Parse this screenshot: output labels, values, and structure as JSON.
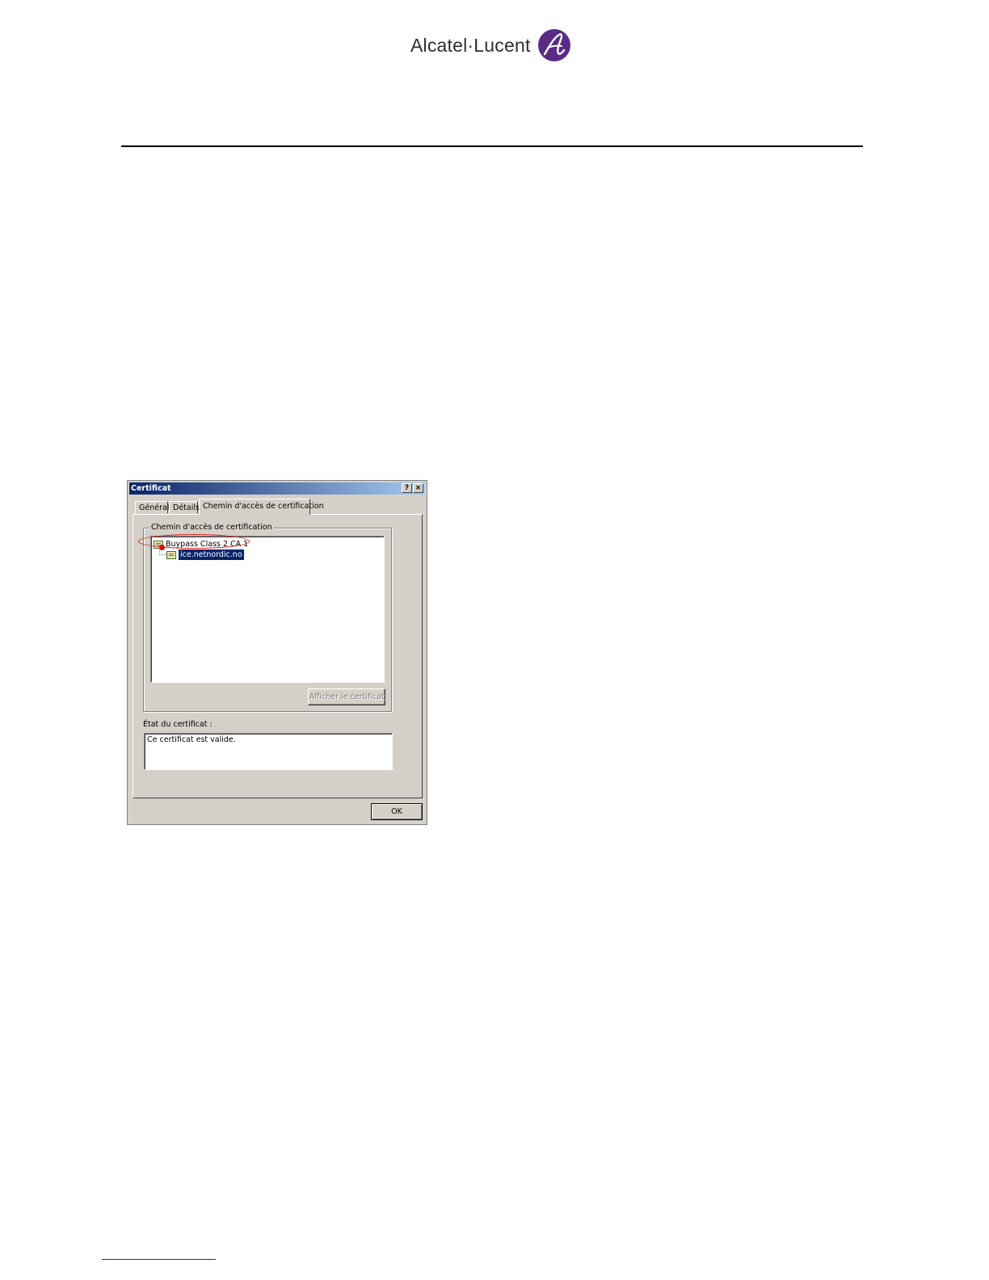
{
  "header": {
    "logo_text": "Alcatel·Lucent",
    "logo_mark_color": "#5b2a86"
  },
  "dialog": {
    "title": "Certificat",
    "title_buttons": {
      "help": "?",
      "close": "×"
    },
    "tabs": [
      {
        "label": "Général",
        "selected": false
      },
      {
        "label": "Détails",
        "selected": false
      },
      {
        "label": "Chemin d'accès de certification",
        "selected": true
      }
    ],
    "group_label": "Chemin d'accès de certification",
    "tree": [
      {
        "label": "Buypass Class 2 CA 1",
        "icon": "certificate-error-icon",
        "highlighted": true
      },
      {
        "label": "ice.netnordic.no",
        "icon": "certificate-icon",
        "selected": true
      }
    ],
    "view_button": "Afficher le certificat",
    "status_label": "État du certificat :",
    "status_text": "Ce certificat est valide.",
    "ok_button": "OK",
    "colors": {
      "face": "#d4d0c8",
      "title_start": "#0a246a",
      "title_end": "#a6caf0",
      "selection": "#0a246a",
      "annotation": "#e02020"
    }
  }
}
